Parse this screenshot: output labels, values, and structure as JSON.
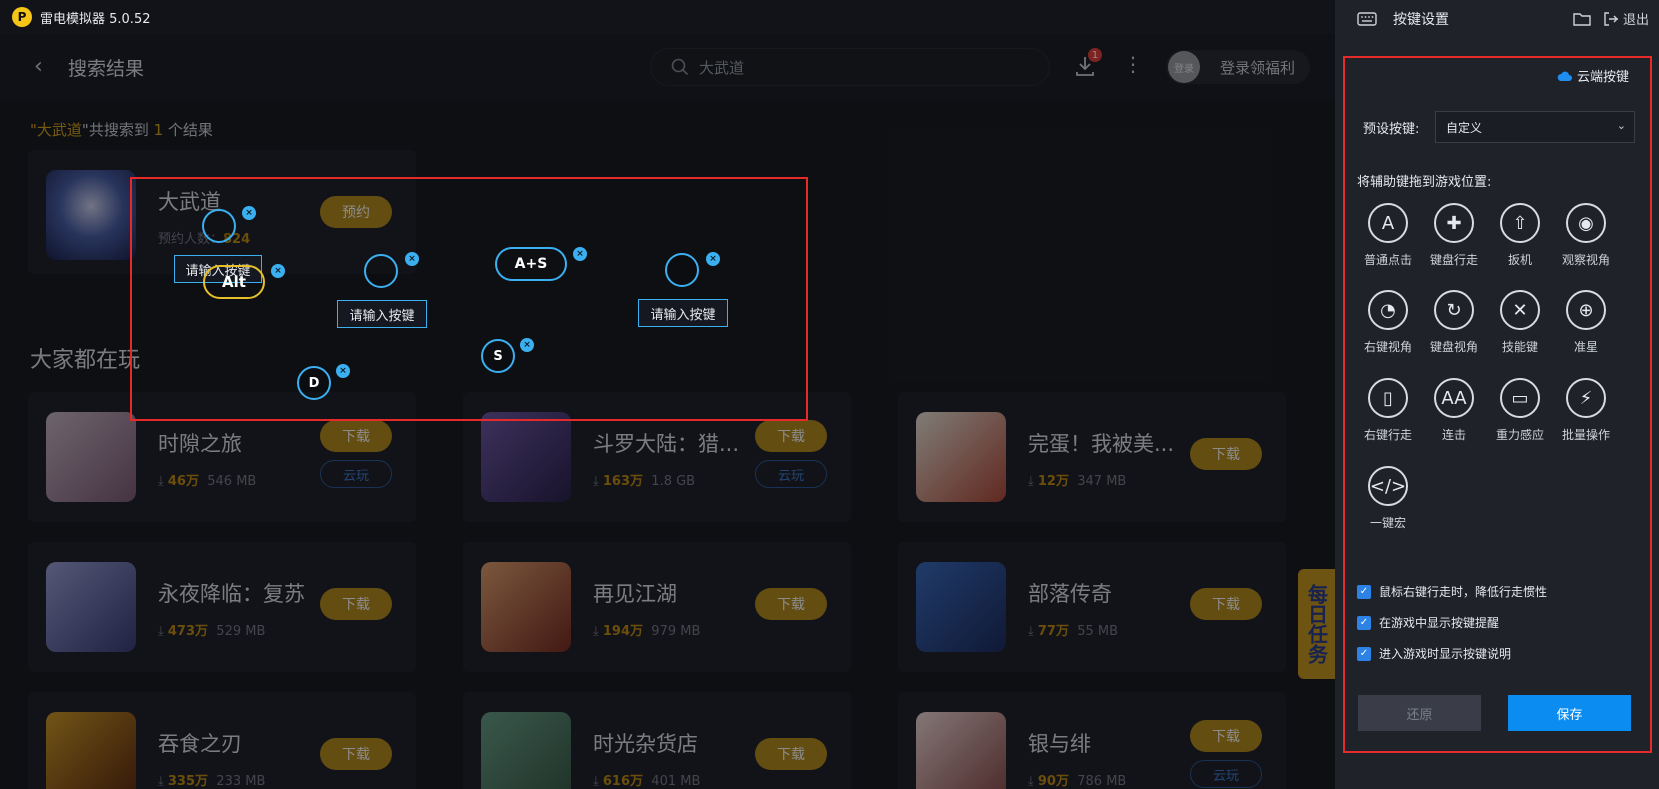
{
  "app": {
    "title": "雷电模拟器 5.0.52",
    "logo_letter": "P"
  },
  "header": {
    "page_title": "搜索结果",
    "search_value": "大武道",
    "download_badge": "1",
    "avatar_text": "登录",
    "login_label": "登录领福利"
  },
  "result": {
    "quote_open": "\"",
    "keyword": "大武道",
    "middle": "\"共搜索到 ",
    "count": "1",
    "suffix": " 个结果"
  },
  "featured": {
    "name": "大武道",
    "meta": "预约人数：",
    "count": "824",
    "button": "预约"
  },
  "section_title": "大家都在玩",
  "games": [
    {
      "name": "时隙之旅",
      "downloads": "46万",
      "size": "546 MB",
      "button": "下载",
      "cloud": "云玩"
    },
    {
      "name": "斗罗大陆：猎...",
      "downloads": "163万",
      "size": "1.8 GB",
      "button": "下载",
      "cloud": "云玩"
    },
    {
      "name": "完蛋！我被美...",
      "downloads": "12万",
      "size": "347 MB",
      "button": "下载"
    },
    {
      "name": "永夜降临：复苏",
      "downloads": "473万",
      "size": "529 MB",
      "button": "下载"
    },
    {
      "name": "再见江湖",
      "downloads": "194万",
      "size": "979 MB",
      "button": "下载"
    },
    {
      "name": "部落传奇",
      "downloads": "77万",
      "size": "55 MB",
      "button": "下载"
    },
    {
      "name": "吞食之刃",
      "downloads": "335万",
      "size": "233 MB",
      "button": "下载"
    },
    {
      "name": "时光杂货店",
      "downloads": "616万",
      "size": "401 MB",
      "button": "下载"
    },
    {
      "name": "银与绯",
      "downloads": "90万",
      "size": "786 MB",
      "button": "下载",
      "cloud": "云玩"
    }
  ],
  "keys": {
    "alt": "Alt",
    "combo": "A+S",
    "s": "S",
    "d": "D",
    "input_placeholder": "请输入按键",
    "close": "×"
  },
  "daily_task": "每日任务",
  "panel": {
    "title": "按键设置",
    "exit": "退出",
    "cloud_keys": "云端按键",
    "preset_label": "预设按键:",
    "preset_value": "自定义",
    "drag_hint": "将辅助键拖到游戏位置:",
    "tools": [
      {
        "label": "普通点击",
        "icon": "tap-a-icon",
        "glyph": "A"
      },
      {
        "label": "键盘行走",
        "icon": "dpad-icon",
        "glyph": "✚"
      },
      {
        "label": "扳机",
        "icon": "trigger-icon",
        "glyph": "⇧"
      },
      {
        "label": "观察视角",
        "icon": "eye-icon",
        "glyph": "◉"
      },
      {
        "label": "右键视角",
        "icon": "mouse-view-icon",
        "glyph": "◔"
      },
      {
        "label": "键盘视角",
        "icon": "rotate-icon",
        "glyph": "↻"
      },
      {
        "label": "技能键",
        "icon": "swords-icon",
        "glyph": "✕"
      },
      {
        "label": "准星",
        "icon": "crosshair-icon",
        "glyph": "⊕"
      },
      {
        "label": "右键行走",
        "icon": "mouse-icon",
        "glyph": "▯"
      },
      {
        "label": "连击",
        "icon": "combo-icon",
        "glyph": "AA"
      },
      {
        "label": "重力感应",
        "icon": "phone-tilt-icon",
        "glyph": "▭"
      },
      {
        "label": "批量操作",
        "icon": "bolt-icon",
        "glyph": "⚡"
      },
      {
        "label": "一键宏",
        "icon": "macro-icon",
        "glyph": "</>"
      }
    ],
    "checks": [
      "鼠标右键行走时，降低行走惯性",
      "在游戏中显示按键提醒",
      "进入游戏时显示按键说明"
    ],
    "restore_label": "还原",
    "save_label": "保存"
  },
  "colors": {
    "accent": "#0b8cf0",
    "gold": "#b48d20",
    "red_box": "#e62a2a",
    "key_blue": "#3bb0f0"
  }
}
